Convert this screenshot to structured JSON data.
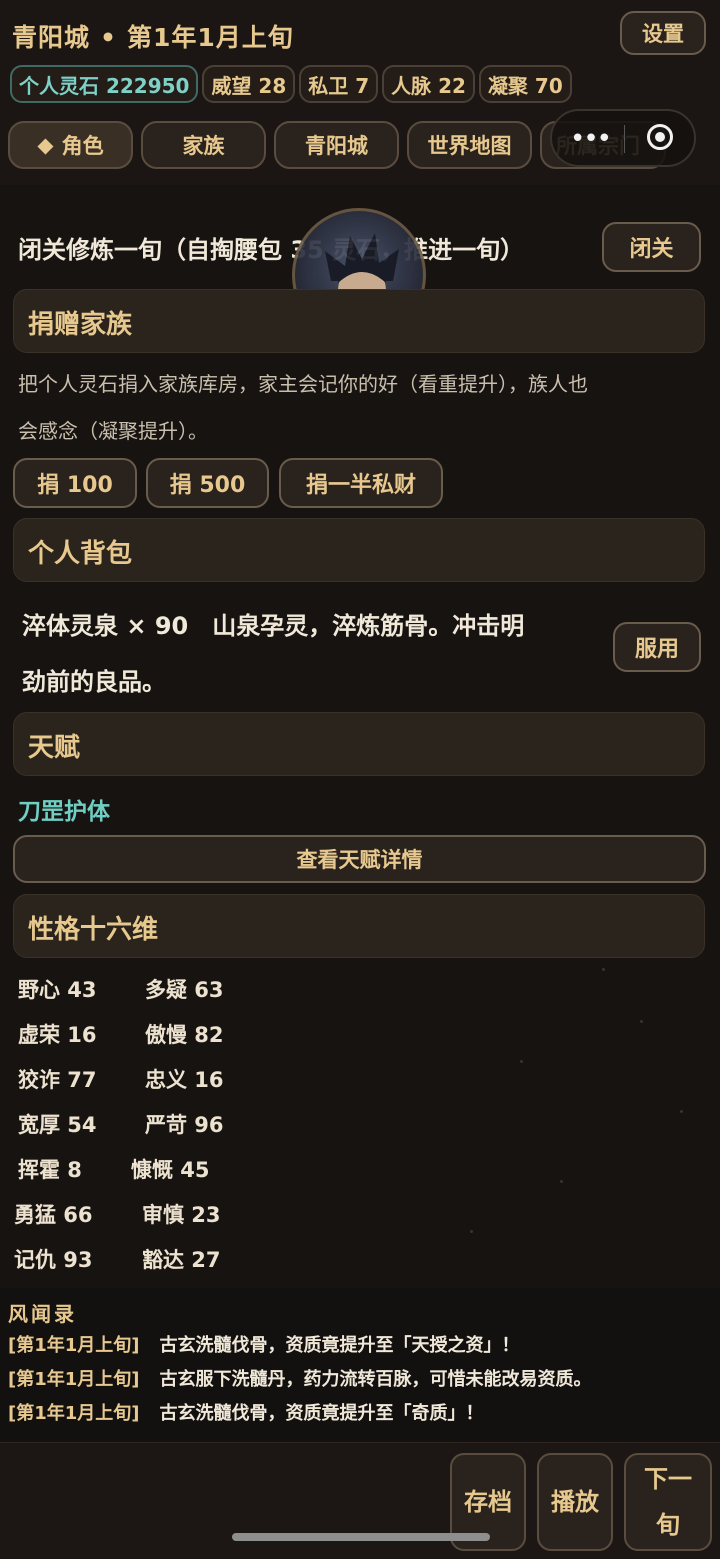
{
  "header": {
    "city": "青阳城",
    "separator": "•",
    "date": "第1年1月上旬",
    "settings_label": "设置",
    "stats": [
      {
        "label": "个人灵石 222950",
        "primary": true
      },
      {
        "label": "威望 28"
      },
      {
        "label": "私卫 7"
      },
      {
        "label": "人脉 22"
      },
      {
        "label": "凝聚 70"
      }
    ],
    "tabs": [
      {
        "label": "角色",
        "icon": "diamond-icon",
        "active": true
      },
      {
        "label": "家族"
      },
      {
        "label": "青阳城"
      },
      {
        "label": "世界地图"
      },
      {
        "label": "所属宗门"
      }
    ],
    "diamond_glyph": "◆"
  },
  "capsule": {
    "dots": "•••"
  },
  "seclusion": {
    "text": "闭关修炼一旬（自掏腰包 35 灵石，推进一旬）",
    "button": "闭关"
  },
  "donate": {
    "title": "捐赠家族",
    "desc_line1": "把个人灵石捐入家族库房，家主会记你的好（看重提升），族人也",
    "desc_line2": "会感念（凝聚提升）。",
    "buttons": [
      "捐 100",
      "捐 500",
      "捐一半私财"
    ]
  },
  "bag": {
    "title": "个人背包",
    "item_line1": "淬体灵泉 × 90　山泉孕灵，淬炼筋骨。冲击明",
    "item_line2": "劲前的良品。",
    "button": "服用"
  },
  "talent": {
    "title": "天赋",
    "name": "刀罡护体",
    "button": "查看天赋详情"
  },
  "personality": {
    "title": "性格十六维",
    "traits": [
      [
        "野心 43",
        "多疑 63"
      ],
      [
        "虚荣 16",
        "傲慢 82"
      ],
      [
        "狡诈 77",
        "忠义 16"
      ],
      [
        "宽厚 54",
        "严苛 96"
      ],
      [
        "挥霍 8",
        "慷慨 45"
      ],
      [
        "勇猛 66",
        "审慎 23"
      ],
      [
        "记仇 93",
        "豁达 27"
      ]
    ]
  },
  "news": {
    "title": "风闻录",
    "items": [
      {
        "ts": "[第1年1月上旬]",
        "text": "古玄洗髓伐骨，资质竟提升至「天授之资」！"
      },
      {
        "ts": "[第1年1月上旬]",
        "text": "古玄服下洗髓丹，药力流转百脉，可惜未能改易资质。"
      },
      {
        "ts": "[第1年1月上旬]",
        "text": "古玄洗髓伐骨，资质竟提升至「奇质」！"
      }
    ]
  },
  "bottom": {
    "save": "存档",
    "play": "播放",
    "next": "下一旬"
  },
  "colors": {
    "accent": "#e7c98f",
    "teal": "#7fd0c6",
    "background": "#171311"
  }
}
